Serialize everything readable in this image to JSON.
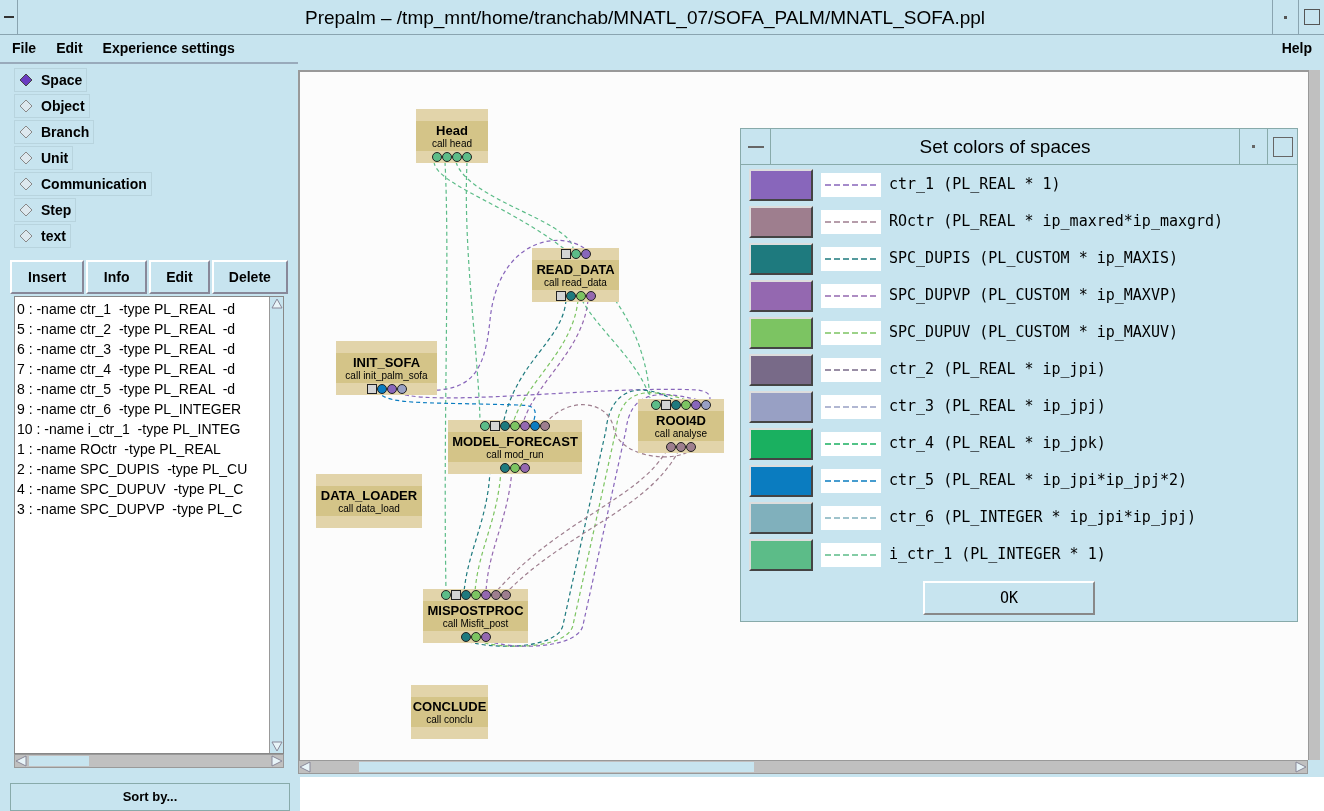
{
  "window": {
    "title": "Prepalm – /tmp_mnt/home/tranchab/MNATL_07/SOFA_PALM/MNATL_SOFA.ppl"
  },
  "menu": [
    {
      "label": "File"
    },
    {
      "label": "Edit"
    },
    {
      "label": "Experience settings"
    }
  ],
  "help_menu": "Help",
  "modes": [
    {
      "label": "Space",
      "selected": true
    },
    {
      "label": "Object",
      "selected": false
    },
    {
      "label": "Branch",
      "selected": false
    },
    {
      "label": "Unit",
      "selected": false
    },
    {
      "label": "Communication",
      "selected": false
    },
    {
      "label": "Step",
      "selected": false
    },
    {
      "label": "text",
      "selected": false
    }
  ],
  "actions": [
    "Insert",
    "Info",
    "Edit",
    "Delete"
  ],
  "list_items": [
    "0 : -name ctr_1  -type PL_REAL  -d",
    "5 : -name ctr_2  -type PL_REAL  -d",
    "6 : -name ctr_3  -type PL_REAL  -d",
    "7 : -name ctr_4  -type PL_REAL  -d",
    "8 : -name ctr_5  -type PL_REAL  -d",
    "9 : -name ctr_6  -type PL_INTEGER",
    "10 : -name i_ctr_1  -type PL_INTEG",
    "1 : -name ROctr  -type PL_REAL",
    "2 : -name SPC_DUPIS  -type PL_CU",
    "4 : -name SPC_DUPUV  -type PL_C",
    "3 : -name SPC_DUPVP  -type PL_C"
  ],
  "sort_button": "Sort by...",
  "nodes": [
    {
      "name": "Head",
      "call": "call head",
      "bottom_ports": [
        {
          "kind": "circle",
          "color": "#5cbc88"
        },
        {
          "kind": "circle",
          "color": "#5cbc88"
        },
        {
          "kind": "circle",
          "color": "#5cbc88"
        },
        {
          "kind": "circle",
          "color": "#5cbc88"
        }
      ]
    },
    {
      "name": "READ_DATA",
      "call": "call read_data",
      "top_ports": [
        {
          "kind": "square"
        },
        {
          "kind": "circle",
          "color": "#5cbc88"
        },
        {
          "kind": "circle",
          "color": "#8866bb"
        }
      ],
      "bottom_ports": [
        {
          "kind": "square"
        },
        {
          "kind": "circle",
          "color": "#1e7a7e"
        },
        {
          "kind": "circle",
          "color": "#7cc462"
        },
        {
          "kind": "circle",
          "color": "#9468b0"
        }
      ]
    },
    {
      "name": "INIT_SOFA",
      "call": "call init_palm_sofa",
      "bottom_ports": [
        {
          "kind": "square"
        },
        {
          "kind": "circle",
          "color": "#0a7cc0"
        },
        {
          "kind": "circle",
          "color": "#8866bb"
        },
        {
          "kind": "circle",
          "color": "#98a0c4"
        }
      ]
    },
    {
      "name": "MODEL_FORECAST",
      "call": "call mod_run",
      "top_ports": [
        {
          "kind": "circle",
          "color": "#5cbc88"
        },
        {
          "kind": "square"
        },
        {
          "kind": "circle",
          "color": "#1e7a7e"
        },
        {
          "kind": "circle",
          "color": "#7cc462"
        },
        {
          "kind": "circle",
          "color": "#9468b0"
        },
        {
          "kind": "circle",
          "color": "#0a7cc0"
        },
        {
          "kind": "circle",
          "color": "#9e7e8e"
        }
      ],
      "bottom_ports": [
        {
          "kind": "circle",
          "color": "#1e7a7e"
        },
        {
          "kind": "circle",
          "color": "#7cc462"
        },
        {
          "kind": "circle",
          "color": "#9468b0"
        }
      ]
    },
    {
      "name": "ROOI4D",
      "call": "call analyse",
      "top_ports": [
        {
          "kind": "circle",
          "color": "#5cbc88"
        },
        {
          "kind": "square"
        },
        {
          "kind": "circle",
          "color": "#1e7a7e"
        },
        {
          "kind": "circle",
          "color": "#7cc462"
        },
        {
          "kind": "circle",
          "color": "#8866bb"
        },
        {
          "kind": "circle",
          "color": "#98a0c4"
        }
      ],
      "bottom_ports": [
        {
          "kind": "circle",
          "color": "#9e7e8e"
        },
        {
          "kind": "circle",
          "color": "#9e7e8e"
        },
        {
          "kind": "circle",
          "color": "#9e7e8e"
        }
      ]
    },
    {
      "name": "DATA_LOADER",
      "call": "call data_load"
    },
    {
      "name": "MISPOSTPROC",
      "call": "call Misfit_post",
      "top_ports": [
        {
          "kind": "circle",
          "color": "#5cbc88"
        },
        {
          "kind": "square"
        },
        {
          "kind": "circle",
          "color": "#1e7a7e"
        },
        {
          "kind": "circle",
          "color": "#7cc462"
        },
        {
          "kind": "circle",
          "color": "#9468b0"
        },
        {
          "kind": "circle",
          "color": "#9e7e8e"
        },
        {
          "kind": "circle",
          "color": "#9e7e8e"
        }
      ],
      "bottom_ports": [
        {
          "kind": "circle",
          "color": "#1e7a7e"
        },
        {
          "kind": "circle",
          "color": "#7cc462"
        },
        {
          "kind": "circle",
          "color": "#9468b0"
        }
      ]
    },
    {
      "name": "CONCLUDE",
      "call": "call conclu"
    }
  ],
  "dialog": {
    "title": "Set colors of spaces",
    "ok": "OK",
    "spaces": [
      {
        "label": "ctr_1 (PL_REAL * 1)",
        "color": "#8866bb"
      },
      {
        "label": "ROctr (PL_REAL * ip_maxred*ip_maxgrd)",
        "color": "#9e7e8e"
      },
      {
        "label": "SPC_DUPIS (PL_CUSTOM * ip_MAXIS)",
        "color": "#1e7a7e"
      },
      {
        "label": "SPC_DUPVP (PL_CUSTOM * ip_MAXVP)",
        "color": "#9468b0"
      },
      {
        "label": "SPC_DUPUV (PL_CUSTOM * ip_MAXUV)",
        "color": "#7cc462"
      },
      {
        "label": "ctr_2 (PL_REAL * ip_jpi)",
        "color": "#786a88"
      },
      {
        "label": "ctr_3 (PL_REAL * ip_jpj)",
        "color": "#98a0c4"
      },
      {
        "label": "ctr_4 (PL_REAL * ip_jpk)",
        "color": "#1ab060"
      },
      {
        "label": "ctr_5 (PL_REAL * ip_jpi*ip_jpj*2)",
        "color": "#0a7cc0"
      },
      {
        "label": "ctr_6 (PL_INTEGER * ip_jpi*ip_jpj)",
        "color": "#80b0bc"
      },
      {
        "label": "i_ctr_1 (PL_INTEGER * 1)",
        "color": "#5cbc88"
      }
    ]
  }
}
